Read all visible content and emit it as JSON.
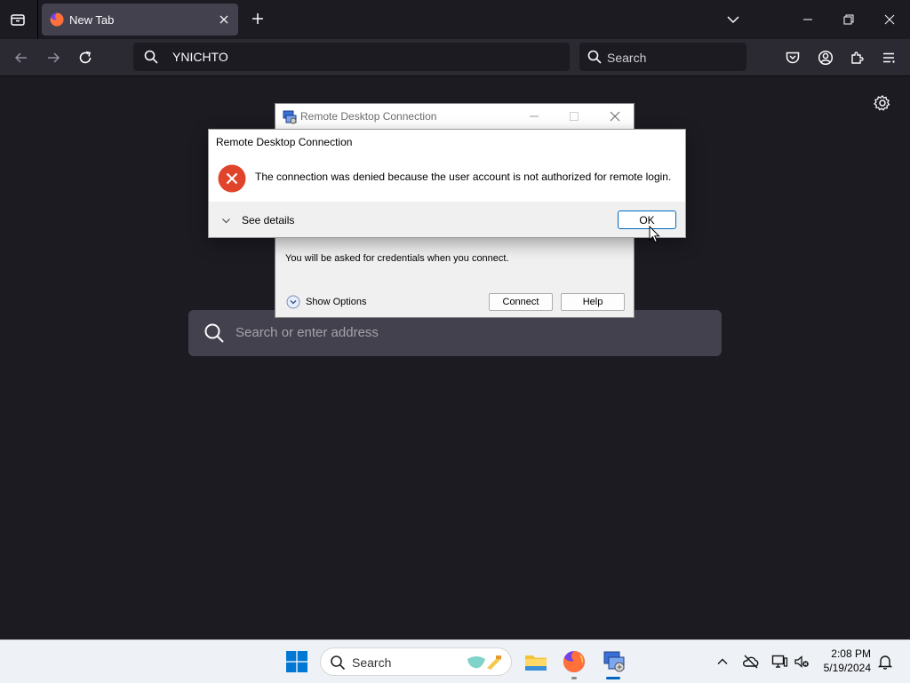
{
  "browser": {
    "tab": {
      "title": "New Tab"
    },
    "url": {
      "value": "YNICHTO"
    },
    "search": {
      "placeholder": "Search"
    }
  },
  "newtab": {
    "search_placeholder": "Search or enter address"
  },
  "rdc_window": {
    "title": "Remote Desktop Connection",
    "hint": "You will be asked for credentials when you connect.",
    "show_options": "Show Options",
    "connect_label": "Connect",
    "help_label": "Help"
  },
  "error_dialog": {
    "title": "Remote Desktop Connection",
    "message": "The connection was denied because the user account is not authorized for remote login.",
    "see_details": "See details",
    "ok_label": "OK"
  },
  "taskbar": {
    "search_label": "Search",
    "time": "2:08 PM",
    "date": "5/19/2024"
  },
  "colors": {
    "firefox_bg": "#1c1b22",
    "toolbar": "#2b2a33",
    "error_red": "#e0442a",
    "ok_border": "#0067c0",
    "win_blue": "#0078d4"
  }
}
